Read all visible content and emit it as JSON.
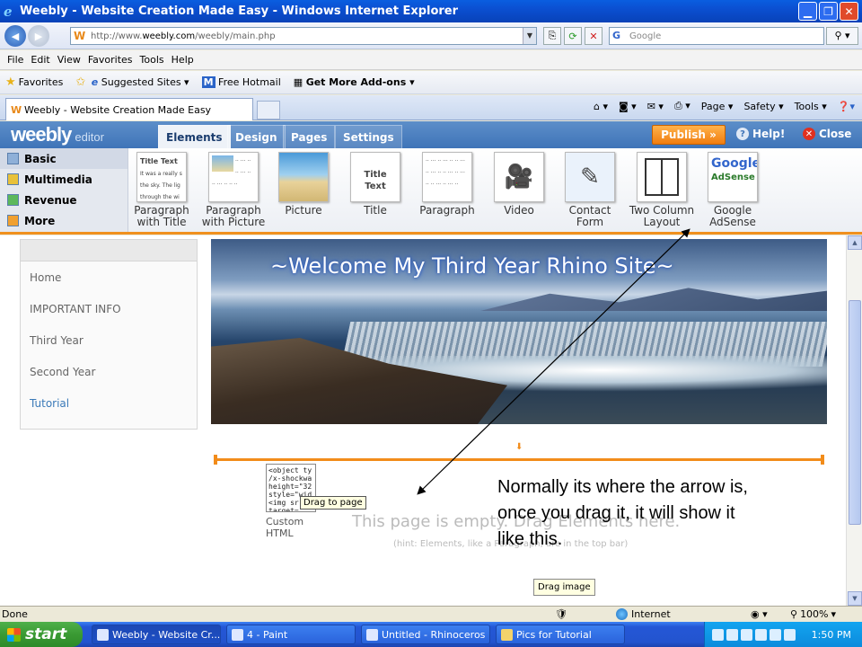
{
  "window": {
    "title": "Weebly - Website Creation Made Easy - Windows Internet Explorer"
  },
  "browser": {
    "url_prefix": "http://www.",
    "url_domain": "weebly.com",
    "url_path": "/weebly/main.php",
    "search_placeholder": "Google",
    "menu": [
      "File",
      "Edit",
      "View",
      "Favorites",
      "Tools",
      "Help"
    ],
    "favorites_label": "Favorites",
    "suggested_sites": "Suggested Sites ▾",
    "free_hotmail": "Free Hotmail",
    "get_addons": "Get More Add-ons ▾",
    "tab_title": "Weebly - Website Creation Made Easy",
    "cmd_page": "Page ▾",
    "cmd_safety": "Safety ▾",
    "cmd_tools": "Tools ▾"
  },
  "editor": {
    "logo": "weebly",
    "logo_sub": "editor",
    "tabs": [
      "Elements",
      "Design",
      "Pages",
      "Settings"
    ],
    "publish": "Publish »",
    "help": "Help!",
    "close": "Close",
    "categories": [
      "Basic",
      "Multimedia",
      "Revenue",
      "More"
    ],
    "elements": [
      {
        "label1": "Paragraph",
        "label2": "with Title",
        "icon": "paragraph-with-title-icon"
      },
      {
        "label1": "Paragraph",
        "label2": "with Picture",
        "icon": "paragraph-with-picture-icon"
      },
      {
        "label1": "Picture",
        "label2": "",
        "icon": "picture-icon"
      },
      {
        "label1": "Title",
        "label2": "",
        "icon": "title-icon"
      },
      {
        "label1": "Paragraph",
        "label2": "",
        "icon": "paragraph-icon"
      },
      {
        "label1": "Video",
        "label2": "",
        "icon": "video-icon"
      },
      {
        "label1": "Contact",
        "label2": "Form",
        "icon": "contact-form-icon"
      },
      {
        "label1": "Two Column",
        "label2": "Layout",
        "icon": "two-column-layout-icon"
      },
      {
        "label1": "Google",
        "label2": "AdSense",
        "icon": "google-adsense-icon"
      }
    ],
    "thumb_title_text": "Title Text",
    "thumb_para_text": "It was a really s the sky. The lig through the wi",
    "adsense_google": "Google",
    "adsense_word": "AdSense"
  },
  "site": {
    "nav": [
      "Home",
      "IMPORTANT INFO",
      "Third Year",
      "Second Year",
      "Tutorial"
    ],
    "banner_title": "~Welcome My Third Year Rhino Site~",
    "empty_message": "This page is empty. Drag Elements here.",
    "hint": "(hint: Elements, like a Paragraph, are in the top bar)",
    "custom_html_code": "<object ty /x-shockwa height=\"32 style=\"wid <img sr target=",
    "custom_html_label1": "Custom",
    "custom_html_label2": "HTML",
    "drag_tooltip": "Drag to page",
    "drag_image_tooltip": "Drag image"
  },
  "annotation": {
    "text": "Normally its where the arrow is, once you drag it, it will show it like this."
  },
  "status": {
    "done": "Done",
    "zone": "Internet",
    "zoom": "100%"
  },
  "taskbar": {
    "start": "start",
    "items": [
      "Weebly - Website Cr...",
      "4 - Paint",
      "Untitled - Rhinoceros ...",
      "Pics for Tutorial"
    ],
    "clock": "1:50 PM"
  }
}
